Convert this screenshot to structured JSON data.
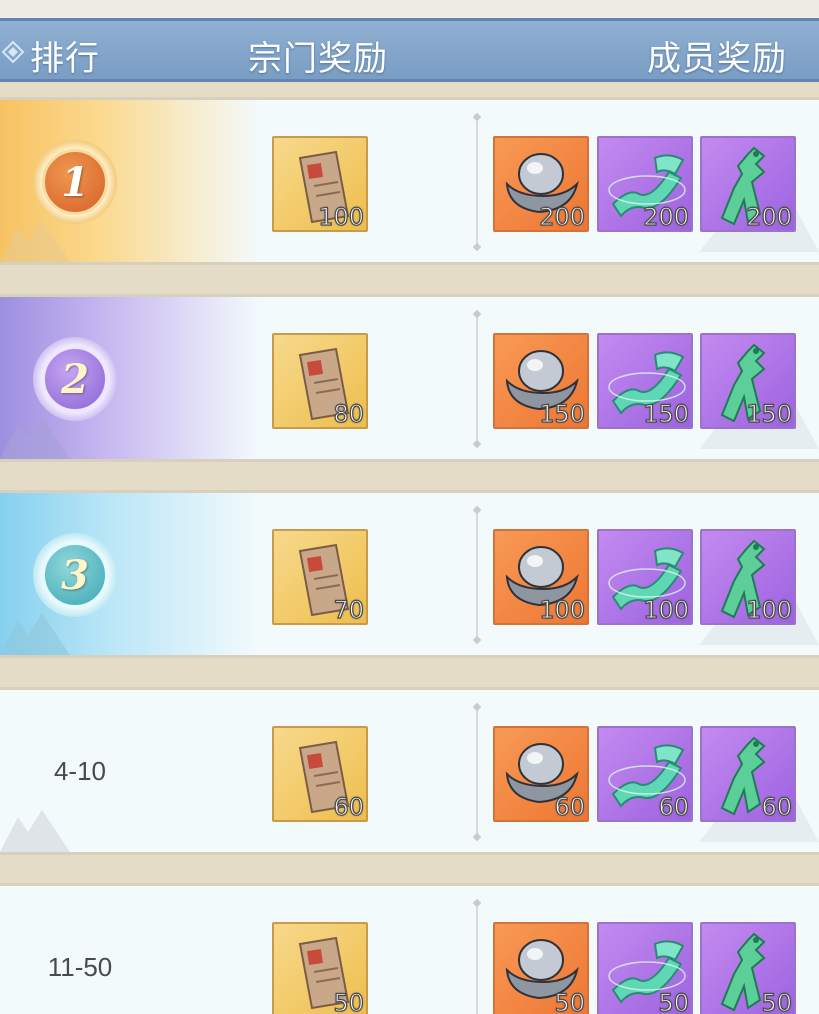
{
  "header": {
    "rank_label": "排行",
    "sect_reward_label": "宗门奖励",
    "member_reward_label": "成员奖励"
  },
  "rows": [
    {
      "rank": "1",
      "medal": true,
      "sect_reward": {
        "icon": "sect-token-icon",
        "qty": "100"
      },
      "member_rewards": [
        {
          "icon": "silver-ingot-icon",
          "qty": "200"
        },
        {
          "icon": "jade-scroll-icon",
          "qty": "200"
        },
        {
          "icon": "jade-pendant-icon",
          "qty": "200"
        }
      ]
    },
    {
      "rank": "2",
      "medal": true,
      "sect_reward": {
        "icon": "sect-token-icon",
        "qty": "80"
      },
      "member_rewards": [
        {
          "icon": "silver-ingot-icon",
          "qty": "150"
        },
        {
          "icon": "jade-scroll-icon",
          "qty": "150"
        },
        {
          "icon": "jade-pendant-icon",
          "qty": "150"
        }
      ]
    },
    {
      "rank": "3",
      "medal": true,
      "sect_reward": {
        "icon": "sect-token-icon",
        "qty": "70"
      },
      "member_rewards": [
        {
          "icon": "silver-ingot-icon",
          "qty": "100"
        },
        {
          "icon": "jade-scroll-icon",
          "qty": "100"
        },
        {
          "icon": "jade-pendant-icon",
          "qty": "100"
        }
      ]
    },
    {
      "rank": "4-10",
      "medal": false,
      "sect_reward": {
        "icon": "sect-token-icon",
        "qty": "60"
      },
      "member_rewards": [
        {
          "icon": "silver-ingot-icon",
          "qty": "60"
        },
        {
          "icon": "jade-scroll-icon",
          "qty": "60"
        },
        {
          "icon": "jade-pendant-icon",
          "qty": "60"
        }
      ]
    },
    {
      "rank": "11-50",
      "medal": false,
      "sect_reward": {
        "icon": "sect-token-icon",
        "qty": "50"
      },
      "member_rewards": [
        {
          "icon": "silver-ingot-icon",
          "qty": "50"
        },
        {
          "icon": "jade-scroll-icon",
          "qty": "50"
        },
        {
          "icon": "jade-pendant-icon",
          "qty": "50"
        }
      ]
    }
  ],
  "colors": {
    "header_blue": "#7a9dc4",
    "gold_tile": "#eebe4c",
    "orange_tile": "#ee7634",
    "purple_tile": "#9c63e0"
  }
}
